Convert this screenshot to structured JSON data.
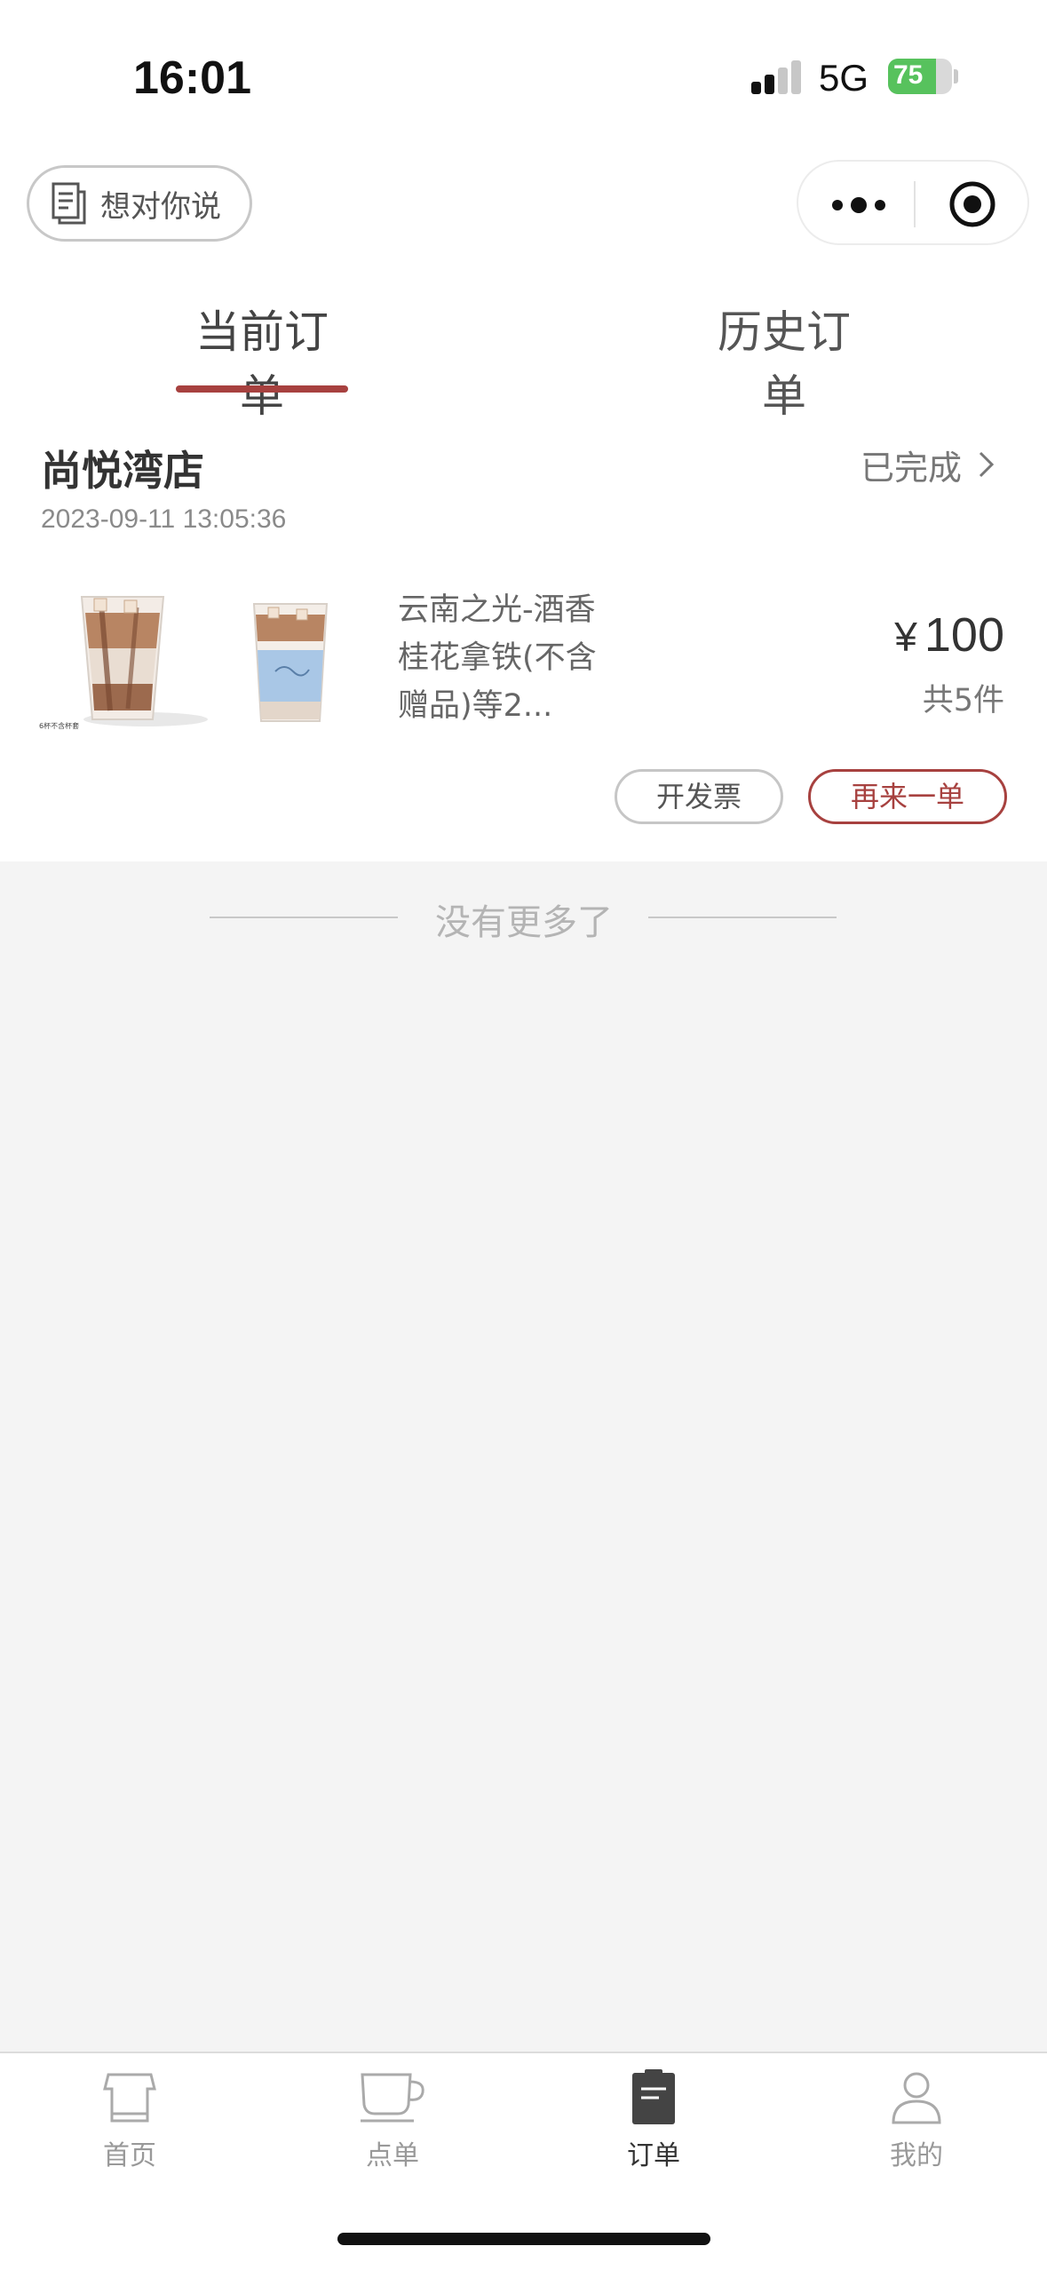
{
  "status_bar": {
    "time": "16:01",
    "network": "5G",
    "battery": "75",
    "battery_level": 0.75
  },
  "nav": {
    "feedback_label": "想对你说",
    "feedback_icon": "notepad-icon",
    "more_icon": "more-dots-icon",
    "close_icon": "target-close-icon"
  },
  "tabs": [
    {
      "label": "当前订单",
      "active": true
    },
    {
      "label": "历史订单",
      "active": false
    }
  ],
  "order": {
    "store_name": "尚悦湾店",
    "status": "已完成",
    "time": "2023-09-11 13:05:36",
    "product_name": "云南之光-酒香桂花拿铁(不含赠品)等2...",
    "currency": "¥",
    "price": "100",
    "count": "共5件",
    "image_caption": "6杯不含杯套",
    "invoice_label": "开发票",
    "reorder_label": "再来一单"
  },
  "no_more": "没有更多了",
  "tabbar": [
    {
      "label": "首页",
      "icon": "shirt-home-icon",
      "active": false
    },
    {
      "label": "点单",
      "icon": "coffee-cup-icon",
      "active": false
    },
    {
      "label": "订单",
      "icon": "clipboard-icon",
      "active": true
    },
    {
      "label": "我的",
      "icon": "person-icon",
      "active": false
    }
  ],
  "colors": {
    "accent": "#a7413f",
    "background": "#f4f4f4",
    "battery_green": "#57c25d"
  }
}
